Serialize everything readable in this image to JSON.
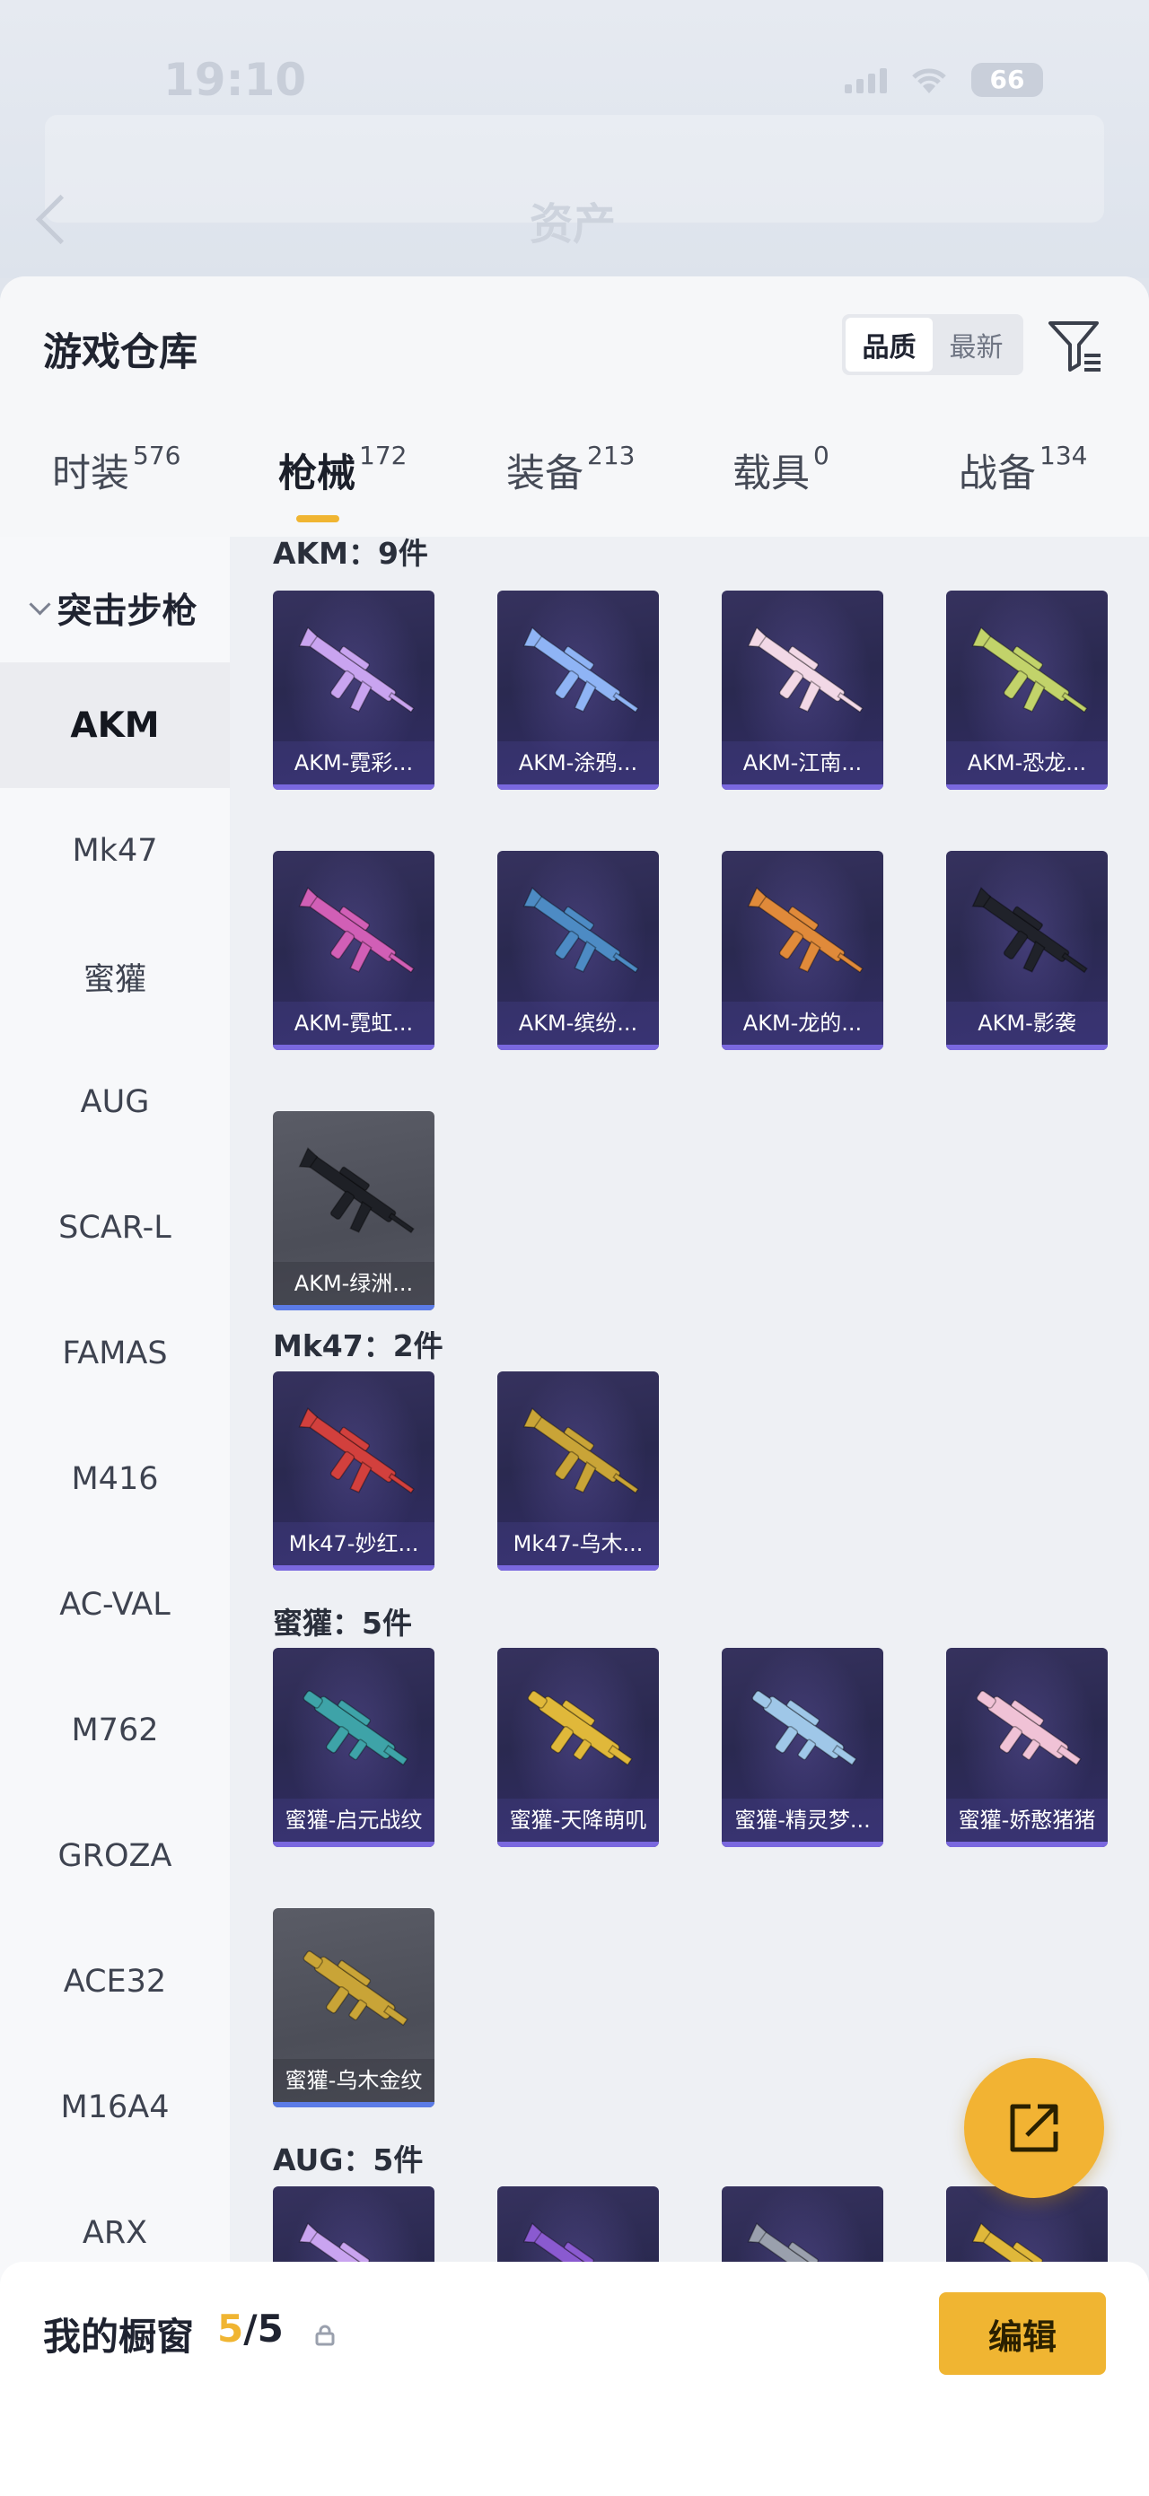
{
  "status_bar": {
    "time": "19:10",
    "battery": "66"
  },
  "header_bg": {
    "faded_title": "资产"
  },
  "sheet": {
    "title": "游戏仓库",
    "sort": {
      "options": [
        "品质",
        "最新"
      ],
      "active": "品质"
    }
  },
  "tabs": [
    {
      "label": "时装",
      "count": "576"
    },
    {
      "label": "枪械",
      "count": "172",
      "active": true
    },
    {
      "label": "装备",
      "count": "213"
    },
    {
      "label": "载具",
      "count": "0"
    },
    {
      "label": "战备",
      "count": "134"
    }
  ],
  "sidebar": {
    "group": "突击步枪",
    "items": [
      "AKM",
      "Mk47",
      "蜜獾",
      "AUG",
      "SCAR-L",
      "FAMAS",
      "M416",
      "AC-VAL",
      "M762",
      "GROZA",
      "ACE32",
      "M16A4",
      "ARX"
    ],
    "active": "AKM"
  },
  "groups": [
    {
      "title": "AKM：9件",
      "items": [
        "AKM-霓彩...",
        "AKM-涂鸦...",
        "AKM-江南...",
        "AKM-恐龙...",
        "AKM-霓虹...",
        "AKM-缤纷...",
        "AKM-龙的...",
        "AKM-影袭",
        "AKM-绿洲..."
      ]
    },
    {
      "title": "Mk47：2件",
      "items": [
        "Mk47-妙红...",
        "Mk47-乌木..."
      ]
    },
    {
      "title": "蜜獾：5件",
      "items": [
        "蜜獾-启元战纹",
        "蜜獾-天降萌叽",
        "蜜獾-精灵梦...",
        "蜜獾-娇憨猪猪",
        "蜜獾-乌木金纹"
      ]
    },
    {
      "title": "AUG：5件",
      "items": [
        "",
        "",
        "",
        ""
      ]
    }
  ],
  "showcase": {
    "title": "我的橱窗",
    "current": "5",
    "total": "/5",
    "edit_label": "编辑"
  },
  "colors": {
    "accent": "#f0b532",
    "card_purple": "#2e2b58",
    "card_grey": "#52545e"
  }
}
